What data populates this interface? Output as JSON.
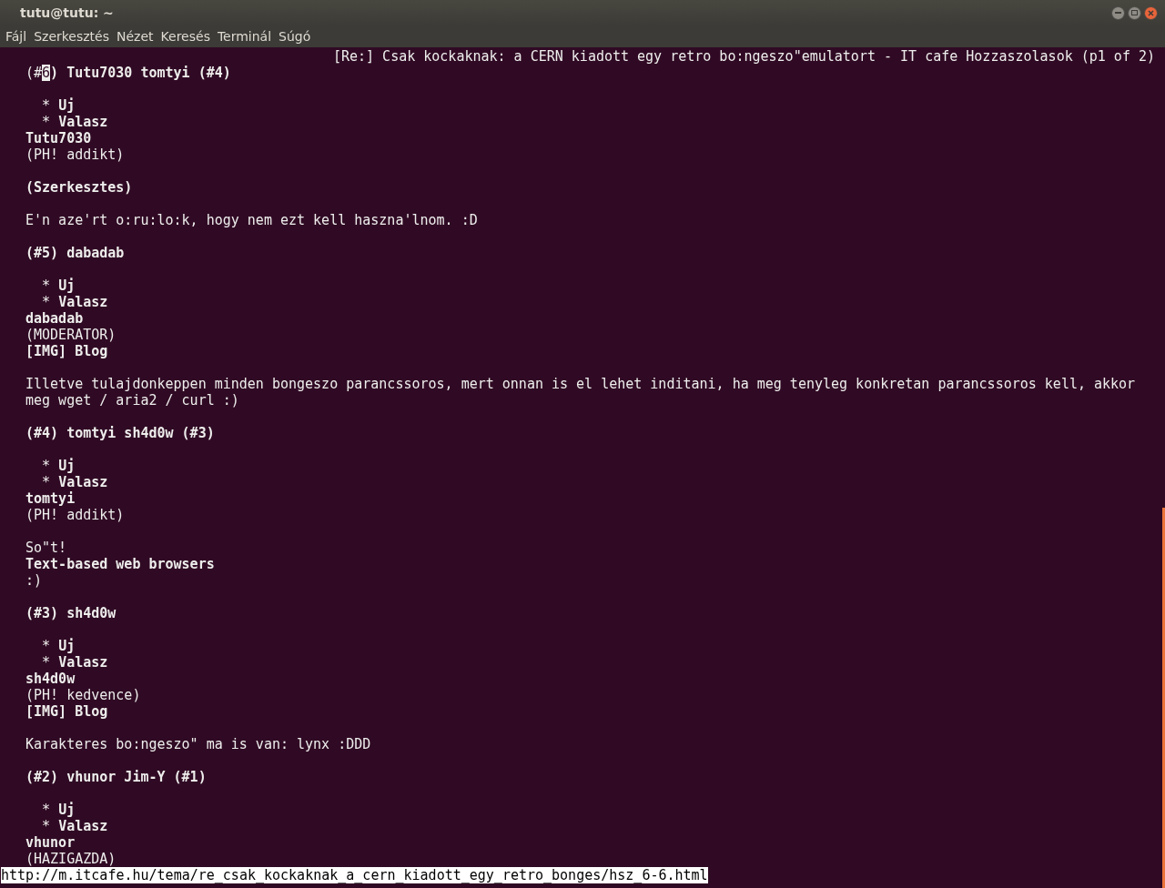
{
  "window": {
    "title": "tutu@tutu: ~"
  },
  "menu": [
    "Fájl",
    "Szerkesztés",
    "Nézet",
    "Keresés",
    "Terminál",
    "Súgó"
  ],
  "page_title": "[Re:] Csak kockaknak: a CERN kiadott egy retro bo:ngeszo\"emulatort - IT cafe Hozzaszolasok (p1 of 2)",
  "lines": [
    {
      "kind": "link",
      "before": "(#",
      "link": "6",
      "after": ") Tutu7030 tomtyi (#4)"
    },
    {
      "kind": "blank"
    },
    {
      "kind": "text",
      "bold": false,
      "text": "  * **Uj**"
    },
    {
      "kind": "text",
      "bold": false,
      "text": "  * **Valasz**"
    },
    {
      "kind": "text",
      "bold": true,
      "text": "Tutu7030"
    },
    {
      "kind": "text",
      "bold": false,
      "text": "(PH! addikt)"
    },
    {
      "kind": "blank"
    },
    {
      "kind": "text",
      "bold": true,
      "text": "(Szerkesztes)"
    },
    {
      "kind": "blank"
    },
    {
      "kind": "text",
      "bold": false,
      "text": "E'n aze'rt o:ru:lo:k, hogy nem ezt kell haszna'lnom. :D"
    },
    {
      "kind": "blank"
    },
    {
      "kind": "text",
      "bold": true,
      "text": "(#5) dabadab"
    },
    {
      "kind": "blank"
    },
    {
      "kind": "text",
      "bold": false,
      "text": "  * **Uj**"
    },
    {
      "kind": "text",
      "bold": false,
      "text": "  * **Valasz**"
    },
    {
      "kind": "text",
      "bold": true,
      "text": "dabadab"
    },
    {
      "kind": "text",
      "bold": false,
      "text": "(MODERATOR)"
    },
    {
      "kind": "text",
      "bold": true,
      "text": "[IMG] Blog"
    },
    {
      "kind": "blank"
    },
    {
      "kind": "text",
      "bold": false,
      "text": "Illetve tulajdonkeppen minden bongeszo parancssoros, mert onnan is el lehet inditani, ha meg tenyleg konkretan parancssoros kell, akkor"
    },
    {
      "kind": "text",
      "bold": false,
      "text": "meg wget / aria2 / curl :)"
    },
    {
      "kind": "blank"
    },
    {
      "kind": "text",
      "bold": true,
      "text": "(#4) tomtyi sh4d0w (#3)"
    },
    {
      "kind": "blank"
    },
    {
      "kind": "text",
      "bold": false,
      "text": "  * **Uj**"
    },
    {
      "kind": "text",
      "bold": false,
      "text": "  * **Valasz**"
    },
    {
      "kind": "text",
      "bold": true,
      "text": "tomtyi"
    },
    {
      "kind": "text",
      "bold": false,
      "text": "(PH! addikt)"
    },
    {
      "kind": "blank"
    },
    {
      "kind": "text",
      "bold": false,
      "text": "So\"t!"
    },
    {
      "kind": "text",
      "bold": true,
      "text": "Text-based web browsers"
    },
    {
      "kind": "text",
      "bold": false,
      "text": ":)"
    },
    {
      "kind": "blank"
    },
    {
      "kind": "text",
      "bold": true,
      "text": "(#3) sh4d0w"
    },
    {
      "kind": "blank"
    },
    {
      "kind": "text",
      "bold": false,
      "text": "  * **Uj**"
    },
    {
      "kind": "text",
      "bold": false,
      "text": "  * **Valasz**"
    },
    {
      "kind": "text",
      "bold": true,
      "text": "sh4d0w"
    },
    {
      "kind": "text",
      "bold": false,
      "text": "(PH! kedvence)"
    },
    {
      "kind": "text",
      "bold": true,
      "text": "[IMG] Blog"
    },
    {
      "kind": "blank"
    },
    {
      "kind": "text",
      "bold": false,
      "text": "Karakteres bo:ngeszo\" ma is van: lynx :DDD"
    },
    {
      "kind": "blank"
    },
    {
      "kind": "text",
      "bold": true,
      "text": "(#2) vhunor Jim-Y (#1)"
    },
    {
      "kind": "blank"
    },
    {
      "kind": "text",
      "bold": false,
      "text": "  * **Uj**"
    },
    {
      "kind": "text",
      "bold": false,
      "text": "  * **Valasz**"
    },
    {
      "kind": "text",
      "bold": true,
      "text": "vhunor"
    },
    {
      "kind": "text",
      "bold": false,
      "text": "(HAZIGAZDA)"
    }
  ],
  "status_url": "http://m.itcafe.hu/tema/re_csak_kockaknak_a_cern_kiadott_egy_retro_bonges/hsz_6-6.html"
}
